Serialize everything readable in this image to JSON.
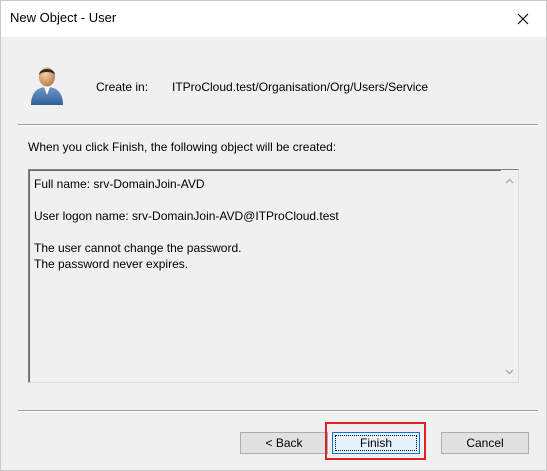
{
  "window": {
    "title": "New Object - User",
    "close_icon": "close-x-icon"
  },
  "header": {
    "icon": "user-icon",
    "create_in_label": "Create in:",
    "create_in_path": "ITProCloud.test/Organisation/Org/Users/Service"
  },
  "intro": "When you click Finish, the following object will be created:",
  "summary": {
    "lines": [
      "Full name: srv-DomainJoin-AVD",
      "",
      "User logon name: srv-DomainJoin-AVD@ITProCloud.test",
      "",
      "The user cannot change the password.",
      "The password never expires."
    ]
  },
  "buttons": {
    "back": "< Back",
    "finish": "Finish",
    "cancel": "Cancel"
  },
  "colors": {
    "highlight": "#e0202c",
    "focus_border": "#0078d7"
  }
}
